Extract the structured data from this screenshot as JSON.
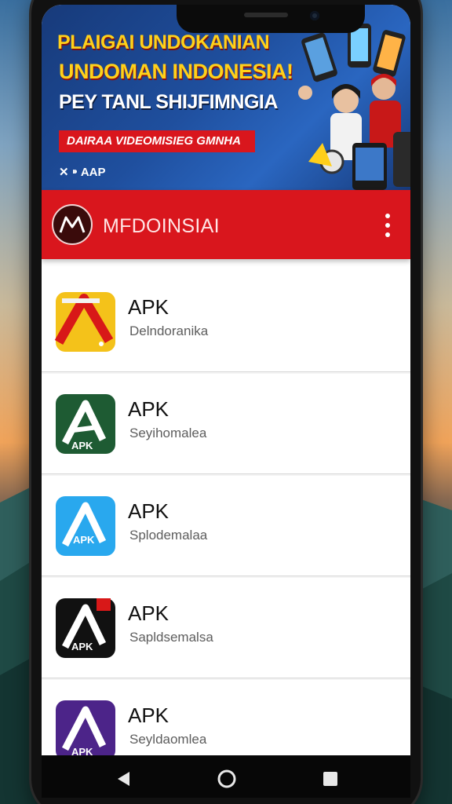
{
  "banner": {
    "line1": "PLAIGAI UNDOKANIAN",
    "line2": "UNDOMAN INDONESIA!",
    "line3": "PEY TANL SHIJFIMNGIA",
    "ribbon": "DAIRAA VIDEOMISIEG GMNHA",
    "small": "✕ ⁍ AAP"
  },
  "appbar": {
    "title": "MFDOINSIAI",
    "logo_icon": "m-logo-icon",
    "menu_icon": "more-vert-icon"
  },
  "apps": [
    {
      "title": "APK",
      "subtitle": "Delndoranika",
      "icon": "yellow-red-a-icon",
      "bg": "#f4c21a",
      "fg": "#d81818",
      "label": ""
    },
    {
      "title": "APK",
      "subtitle": "Seyihomalea",
      "icon": "green-apk-icon",
      "bg": "#1e5b33",
      "fg": "#ffffff",
      "label": "APK"
    },
    {
      "title": "APK",
      "subtitle": "Splodemalaa",
      "icon": "blue-apk-icon",
      "bg": "#29a8ee",
      "fg": "#ffffff",
      "label": "APK"
    },
    {
      "title": "APK",
      "subtitle": "Sapldsemalsa",
      "icon": "black-apk-icon",
      "bg": "#111111",
      "fg": "#ffffff",
      "label": "APK"
    },
    {
      "title": "APK",
      "subtitle": "Seyldaomlea",
      "icon": "purple-apk-icon",
      "bg": "#4c2489",
      "fg": "#ffffff",
      "label": "APK"
    }
  ],
  "navbar": {
    "back_icon": "back-triangle-icon",
    "home_icon": "home-circle-icon",
    "recents_icon": "recents-square-icon"
  },
  "colors": {
    "accent": "#d9161d",
    "banner_text": "#ffd11a"
  }
}
